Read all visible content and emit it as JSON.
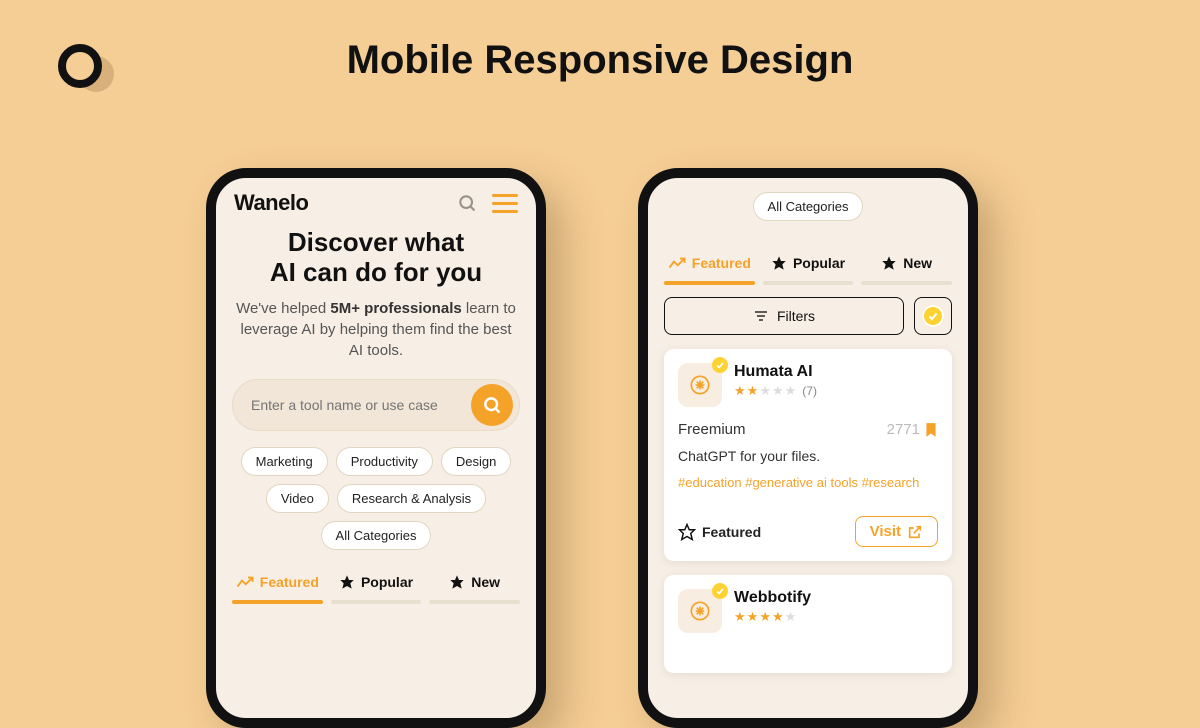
{
  "page_title": "Mobile Responsive Design",
  "phone1": {
    "brand": "Wanelo",
    "hero_line1": "Discover what",
    "hero_line2": "AI can do for you",
    "hero_sub_pre": "We've helped ",
    "hero_sub_bold": "5M+ professionals",
    "hero_sub_post": " learn to leverage AI by helping them find the best AI tools.",
    "search_placeholder": "Enter a tool name or use case",
    "chips": [
      "Marketing",
      "Productivity",
      "Design",
      "Video",
      "Research & Analysis",
      "All Categories"
    ],
    "tabs": {
      "featured": "Featured",
      "popular": "Popular",
      "new": "New"
    }
  },
  "phone2": {
    "all_categories": "All Categories",
    "tabs": {
      "featured": "Featured",
      "popular": "Popular",
      "new": "New"
    },
    "filters_label": "Filters",
    "card1": {
      "title": "Humata AI",
      "rating_count": "(7)",
      "stars_filled": 2,
      "pricing": "Freemium",
      "saves": "2771",
      "description": "ChatGPT for your files.",
      "tags": "#education #generative ai tools #research",
      "featured_label": "Featured",
      "visit_label": "Visit"
    },
    "card2": {
      "title": "Webbotify"
    }
  }
}
